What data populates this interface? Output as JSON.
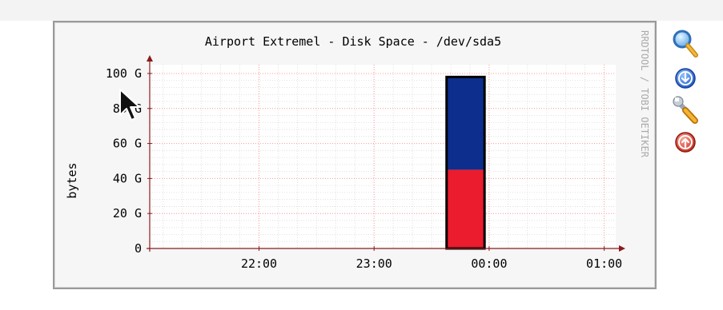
{
  "chart_data": {
    "type": "bar",
    "title": "Airport Extremel - Disk Space - /dev/sda5",
    "ylabel": "bytes",
    "watermark": "RRDTOOL / TOBI OETIKER",
    "y_ticks": [
      "0",
      "20 G",
      "40 G",
      "60 G",
      "80 G",
      "100 G"
    ],
    "y_tick_values": [
      0,
      20,
      40,
      60,
      80,
      100
    ],
    "ylim": [
      0,
      105
    ],
    "x_ticks": [
      "22:00",
      "23:00",
      "00:00",
      "01:00"
    ],
    "x_tick_values": [
      22.0,
      23.0,
      24.0,
      25.0
    ],
    "xlim": [
      21.05,
      25.1
    ],
    "grid": true,
    "colors": {
      "used": "#ea1c2e",
      "free": "#0d2e8d",
      "grid": "#ff9a9a",
      "axis": "#8b1a1a",
      "outline": "#000000"
    },
    "bars": [
      {
        "x_start": 23.63,
        "x_end": 23.96,
        "used": 45,
        "total": 98
      }
    ]
  },
  "icons": [
    {
      "name": "zoom-icon",
      "color": "#3a7fd5"
    },
    {
      "name": "download-icon",
      "color": "#2a62c9"
    },
    {
      "name": "settings-icon",
      "color": "#e0a020"
    },
    {
      "name": "upload-icon",
      "color": "#cc3b2e"
    }
  ]
}
